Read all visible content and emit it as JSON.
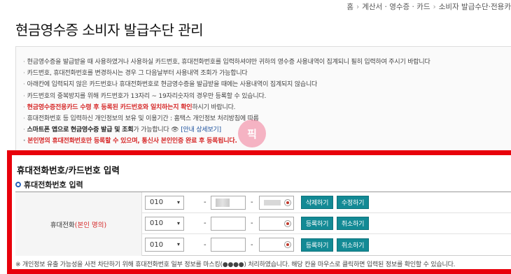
{
  "breadcrumb": {
    "home_icon": "home-icon",
    "items": [
      "홈",
      "계산서 · 영수증 · 카드",
      "소비자 발급수단 관리 · 전용카드 관리"
    ],
    "sep": "›",
    "visible_last": "소비자 발급수단·전용카"
  },
  "page_title": "현금영수증 소비자 발급수단 관리",
  "notices": [
    "현금영수증을 발급받을 때 사용하였거나 사용하실 카드번호, 휴대전화번호를 입력하셔야만 귀하의 영수증 사용내역이 집계되니 필히 입력하여 주시기 바랍니다",
    "카드번호, 휴대전화번호를 변경하시는 경우 그 다음날부터 사용내역 조회가 가능합니다",
    "아래칸에 입력되지 않은 카드번호나 휴대전화번호로 현금영수증을 발급받을 때에는 사용내역이 집계되지 않습니다",
    "카드번호의 중복방지를 위해 카드번호가 13자리 ~ 19자리숫자의 경우만 등록할 수 있습니다."
  ],
  "notice_red_1": "현금영수증전용카드 수령 후 등록된 카드번호와 일치하는지 확인",
  "notice_red_1_suffix": "하시기 바랍니다.",
  "notice_privacy": "휴대전화번호 등 입력하신 개인정보의 보유 및 이용기간 : 홈택스 개인정보 처리방침에 따름",
  "notice_app_prefix": "스마트폰 앱으로",
  "notice_app_bold_1": "현금영수증 발급 및 조회",
  "notice_app_mid": "가 가능합니다",
  "notice_app_link": "[안내 상세보기]",
  "notice_red_2": "본인명의 휴대전화번호만 등록할 수 있으며, 통신사 본인인증 완료 후 등록됩니다.",
  "pick_badge": "픽",
  "section_title": "휴대전화번호/카드번호 입력",
  "sub_title": "휴대전화번호 입력",
  "label": {
    "prefix": "휴대전화",
    "red": "(본인 명의)"
  },
  "rows": [
    {
      "area": "010",
      "btn1": "삭제하기",
      "btn2": "수정하기"
    },
    {
      "area": "010",
      "btn1": "등록하기",
      "btn2": "취소하기"
    },
    {
      "area": "010",
      "btn1": "등록하기",
      "btn2": "취소하기"
    }
  ],
  "dash": "-",
  "footnote": "※ 개인정보 유출 가능성을 사전 차단하기 위해 휴대전화번호 일부 정보를 마스킹(●●●●) 처리하였습니다. 해당 칸을 마우스로 클릭하면 입력된 정보를 확인할 수 있습니다.",
  "colors": {
    "accent_button": "#138a95",
    "highlight_frame": "#e8000b",
    "notice_red": "#d62727",
    "link_blue": "#1a4f9c"
  }
}
